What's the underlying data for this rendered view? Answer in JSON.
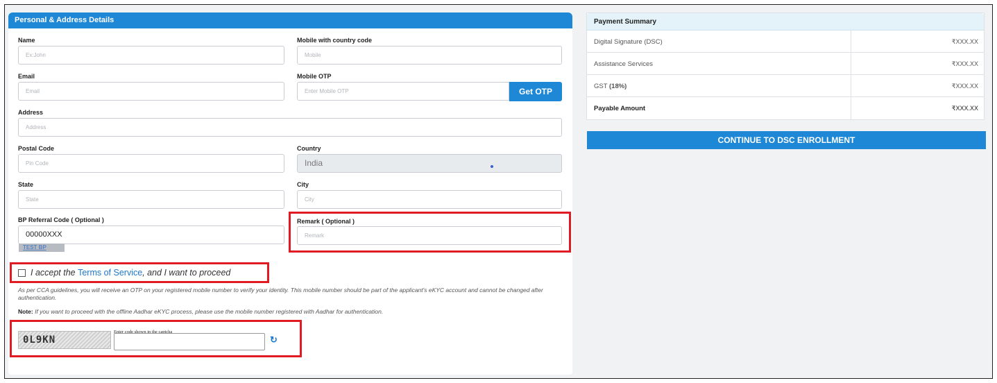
{
  "form": {
    "section_title": "Personal & Address Details",
    "name": {
      "label": "Name",
      "placeholder": "Ex:John"
    },
    "mobile": {
      "label": "Mobile with country code",
      "placeholder": "Mobile"
    },
    "email": {
      "label": "Email",
      "placeholder": "Email"
    },
    "mobile_otp": {
      "label": "Mobile OTP",
      "placeholder": "Enter Mobile OTP",
      "button": "Get OTP"
    },
    "address": {
      "label": "Address",
      "placeholder": "Address"
    },
    "postal_code": {
      "label": "Postal Code",
      "placeholder": "Pin Code"
    },
    "country": {
      "label": "Country",
      "value": "India"
    },
    "state": {
      "label": "State",
      "placeholder": "State"
    },
    "city": {
      "label": "City",
      "placeholder": "City"
    },
    "referral": {
      "label": "BP Referral Code ( Optional )",
      "value": "00000XXX",
      "tag": "TEST BP"
    },
    "remark": {
      "label": "Remark ( Optional )",
      "placeholder": "Remark"
    }
  },
  "terms": {
    "prefix": "I accept the ",
    "link": "Terms of Service",
    "suffix": ", and I want to proceed"
  },
  "info_text": "As per CCA guidelines, you will receive an OTP on your registered mobile number to verify your identity. This mobile number should be part of the applicant's eKYC account and cannot be changed after authentication.",
  "note": {
    "label": "Note:",
    "text": " If you want to proceed with the offline Aadhar eKYC process, please use the mobile number registered with Aadhar for authentication."
  },
  "captcha": {
    "code": "0L9KN",
    "label": "Enter code shown in the captcha",
    "refresh_icon": "↻"
  },
  "summary": {
    "title": "Payment Summary",
    "rows": [
      {
        "label": "Digital Signature (DSC)",
        "value": "₹XXX.XX"
      },
      {
        "label": "Assistance Services",
        "value": "₹XXX.XX"
      },
      {
        "label_main": "GST ",
        "label_bold": "(18%)",
        "value": "₹XXX.XX"
      },
      {
        "label": "Payable Amount",
        "value": "₹XXX.XX"
      }
    ],
    "continue_button": "CONTINUE TO DSC ENROLLMENT"
  },
  "colors": {
    "accent": "#1e88d6",
    "highlight": "#e01b24"
  }
}
